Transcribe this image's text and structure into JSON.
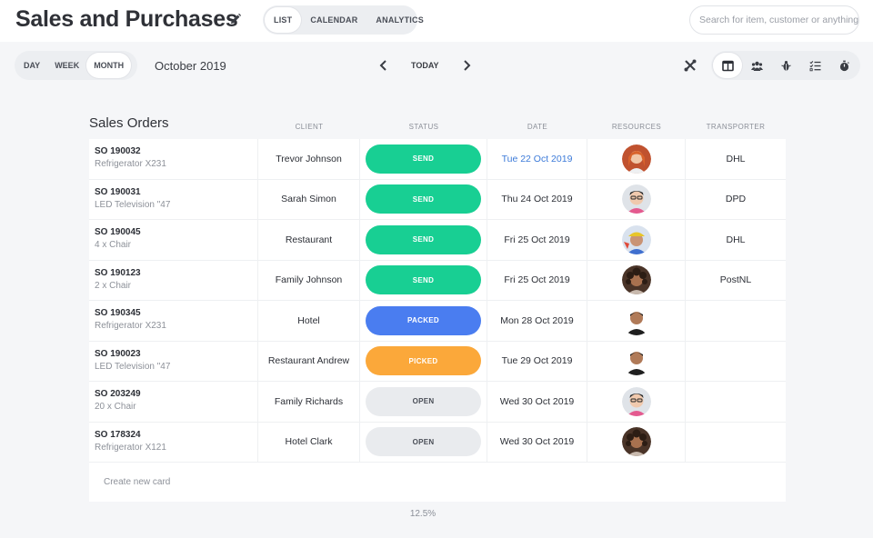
{
  "header": {
    "title": "Sales and Purchases",
    "tabs": [
      "LIST",
      "CALENDAR",
      "ANALYTICS"
    ],
    "active_tab": "LIST",
    "search_placeholder": "Search for item, customer or anything"
  },
  "toolbar": {
    "ranges": [
      "DAY",
      "WEEK",
      "MONTH"
    ],
    "active_range": "MONTH",
    "period": "October 2019",
    "today_label": "TODAY",
    "layout_icons": [
      "columns-icon",
      "team-icon",
      "bug-icon",
      "checklist-icon",
      "stopwatch-icon"
    ]
  },
  "table": {
    "title": "Sales Orders",
    "columns": [
      "CLIENT",
      "STATUS",
      "DATE",
      "RESOURCES",
      "TRANSPORTER"
    ],
    "rows": [
      {
        "id": "SO 190032",
        "item": "Refrigerator X231",
        "client": "Trevor Johnson",
        "status": "SEND",
        "date": "Tue 22 Oct 2019",
        "date_highlight": true,
        "avatar": "woman-redhair",
        "transporter": "DHL"
      },
      {
        "id": "SO 190031",
        "item": "LED Television \"47",
        "client": "Sarah Simon",
        "status": "SEND",
        "date": "Thu 24 Oct 2019",
        "date_highlight": false,
        "avatar": "man-glasses",
        "transporter": "DPD"
      },
      {
        "id": "SO 190045",
        "item": "4 x Chair",
        "client": "Restaurant",
        "status": "SEND",
        "date": "Fri 25 Oct 2019",
        "date_highlight": false,
        "avatar": "man-hat",
        "transporter": "DHL"
      },
      {
        "id": "SO 190123",
        "item": "2 x Chair",
        "client": "Family Johnson",
        "status": "SEND",
        "date": "Fri 25 Oct 2019",
        "date_highlight": false,
        "avatar": "woman-curly",
        "transporter": "PostNL"
      },
      {
        "id": "SO 190345",
        "item": "Refrigerator X231",
        "client": "Hotel",
        "status": "PACKED",
        "date": "Mon 28 Oct 2019",
        "date_highlight": false,
        "avatar": "man-dark",
        "transporter": ""
      },
      {
        "id": "SO 190023",
        "item": "LED Television \"47",
        "client": "Restaurant Andrew",
        "status": "PICKED",
        "date": "Tue 29 Oct 2019",
        "date_highlight": false,
        "avatar": "man-dark",
        "transporter": ""
      },
      {
        "id": "SO 203249",
        "item": "20 x Chair",
        "client": "Family Richards",
        "status": "OPEN",
        "date": "Wed 30 Oct 2019",
        "date_highlight": false,
        "avatar": "man-glasses",
        "transporter": ""
      },
      {
        "id": "SO 178324",
        "item": "Refrigerator X121",
        "client": "Hotel Clark",
        "status": "OPEN",
        "date": "Wed 30 Oct 2019",
        "date_highlight": false,
        "avatar": "woman-curly",
        "transporter": ""
      }
    ],
    "create_label": "Create new card"
  },
  "status_colors": {
    "SEND": "#18cf93",
    "PACKED": "#4a7df0",
    "PICKED": "#fba83a",
    "OPEN": "#e9ebee"
  },
  "progress_label": "12.5%"
}
